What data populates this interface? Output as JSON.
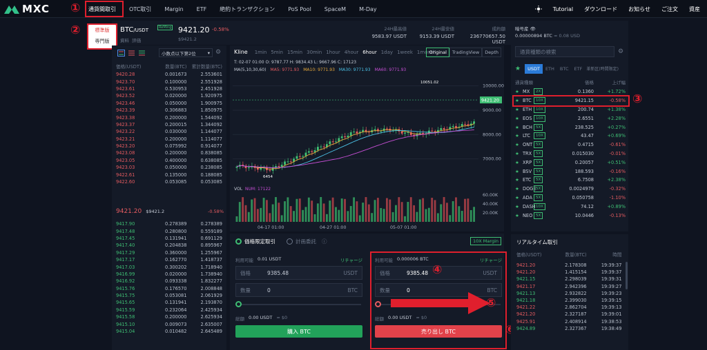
{
  "nav": {
    "logo": "MXC",
    "items": [
      "通貨間取引",
      "OTC取引",
      "Margin",
      "ETF",
      "絶約トランザクション",
      "PoS Pool",
      "SpaceM",
      "M-Day"
    ],
    "right": [
      "Tutorial",
      "ダウンロード",
      "お知らせ",
      "ご注文",
      "資産"
    ],
    "sun_icon": "sun-icon"
  },
  "dropdown": {
    "items": [
      "標準版",
      "専門版"
    ]
  },
  "markers": {
    "m1": "①",
    "m2": "②",
    "m3": "③",
    "m4": "④",
    "m5": "⑤",
    "m6": "⑥"
  },
  "ticker": {
    "pair": "BTC",
    "quote": "/USDT",
    "badge": "ReMing",
    "sub1": "資料",
    "sub2": "評価",
    "price": "9421.20",
    "change": "-0.58%",
    "price_sub": "$9421.2",
    "high_label": "24H最高値",
    "high": "9583.97 USDT",
    "low_label": "24H最安値",
    "low": "9153.39 USDT",
    "vol_label": "成約額",
    "vol": "236770657.50 USDT"
  },
  "orderbook": {
    "precision": "小数点以下第2位",
    "headers": [
      "価格(USDT)",
      "数量(BTC)",
      "累計数量(BTC)"
    ],
    "asks": [
      [
        "9420.28",
        "0.001673",
        "2.553601"
      ],
      [
        "9423.70",
        "0.100000",
        "2.551928"
      ],
      [
        "9423.61",
        "0.530953",
        "2.451928"
      ],
      [
        "9423.52",
        "0.020000",
        "1.920975"
      ],
      [
        "9423.46",
        "0.050000",
        "1.900975"
      ],
      [
        "9423.39",
        "0.306883",
        "1.850975"
      ],
      [
        "9423.38",
        "0.200000",
        "1.544092"
      ],
      [
        "9423.37",
        "0.200015",
        "1.344092"
      ],
      [
        "9423.22",
        "0.030000",
        "1.144077"
      ],
      [
        "9423.21",
        "0.200000",
        "1.114077"
      ],
      [
        "9423.20",
        "0.075992",
        "0.914077"
      ],
      [
        "9423.08",
        "0.200000",
        "0.838085"
      ],
      [
        "9423.05",
        "0.400000",
        "0.638085"
      ],
      [
        "9423.03",
        "0.050000",
        "0.238085"
      ],
      [
        "9422.61",
        "0.135000",
        "0.188085"
      ],
      [
        "9422.60",
        "0.053085",
        "0.053085"
      ]
    ],
    "mid_price": "9421.20",
    "mid_usd": "$9421.2",
    "mid_change": "-0.58%",
    "bids": [
      [
        "9417.90",
        "0.278389",
        "0.278389"
      ],
      [
        "9417.48",
        "0.280800",
        "0.559189"
      ],
      [
        "9417.45",
        "0.131941",
        "0.691129"
      ],
      [
        "9417.40",
        "0.204838",
        "0.895967"
      ],
      [
        "9417.29",
        "0.360000",
        "1.255967"
      ],
      [
        "9417.17",
        "0.162770",
        "1.418737"
      ],
      [
        "9417.03",
        "0.300202",
        "1.718940"
      ],
      [
        "9416.99",
        "0.020000",
        "1.738940"
      ],
      [
        "9416.92",
        "0.093338",
        "1.832277"
      ],
      [
        "9415.76",
        "0.176570",
        "2.008848"
      ],
      [
        "9415.75",
        "0.053081",
        "2.061929"
      ],
      [
        "9415.65",
        "0.131941",
        "2.193870"
      ],
      [
        "9415.59",
        "0.232064",
        "2.425934"
      ],
      [
        "9415.58",
        "0.200000",
        "2.625934"
      ],
      [
        "9415.10",
        "0.009073",
        "2.635007"
      ],
      [
        "9415.04",
        "0.010482",
        "2.645489"
      ]
    ]
  },
  "chart": {
    "title": "Kline",
    "intervals": [
      "1min",
      "5min",
      "15min",
      "30min",
      "1hour",
      "4hour",
      "6hour",
      "1day",
      "1week",
      "1month"
    ],
    "active_interval": "6hour",
    "views": [
      "Original",
      "TradingView",
      "Depth"
    ],
    "ohlc": "T: 02-07 01:00   O: 9787.77   H: 9834.43   L: 9667.96   C: 17123",
    "ma_label": "MA(5,10,30,60)",
    "ma5": "MA5: 9771.93",
    "ma10": "MA10: 9771.93",
    "ma30": "MA30: 9771.93",
    "ma60": "MA60: 9771.93",
    "high_mark": "10051.02",
    "low_mark": "6454",
    "current": "9421.20",
    "y_ticks": [
      "10000.00",
      "9000.00",
      "8000.00",
      "7000.00"
    ],
    "vol_label": "VOL",
    "vol_value": "NUM: 17122",
    "vol_ticks": [
      "60.00K",
      "40.00K",
      "20.00K"
    ],
    "x_ticks": [
      "04-17 01:00",
      "04-27 01:00",
      "05-07 01:00"
    ]
  },
  "trade": {
    "tab1": "価格限定取引",
    "tab2": "計画委託",
    "margin": "10X Margin",
    "buy": {
      "avail_label": "利用可能",
      "avail": "0.01 USDT",
      "recharge": "リチャージ",
      "price_label": "価格",
      "price": "9385.48",
      "price_unit": "USDT",
      "qty_label": "数量",
      "qty": "0",
      "qty_unit": "BTC",
      "total_label": "総額",
      "total": "0.00 USDT",
      "total_usd": "≈ $0",
      "button": "購入 BTC"
    },
    "sell": {
      "avail_label": "利用可能",
      "avail": "0.000006 BTC",
      "recharge": "リチャージ",
      "price_label": "価格",
      "price": "9385.48",
      "price_unit": "USDT",
      "qty_label": "数量",
      "qty": "0",
      "qty_unit": "BTC",
      "total_label": "総額",
      "total": "0.00 USDT",
      "total_usd": "≈ $0",
      "button": "売り出し BTC"
    }
  },
  "market": {
    "fav_label": "暗号産",
    "fav_value": "0.00000894 BTC",
    "fav_usd": "≈ 0.08 USD",
    "search_placeholder": "通貨種類の検索",
    "tabs": [
      "USDT",
      "ETH",
      "BTC",
      "ETF",
      "革新区(時間限定)"
    ],
    "headers": [
      "通貨種類",
      "価格",
      "上げ幅"
    ],
    "rows": [
      [
        "MX",
        "2X",
        "0.1360",
        "+1.72%"
      ],
      [
        "BTC",
        "10X",
        "9421.15",
        "-0.58%"
      ],
      [
        "ETH",
        "10X",
        "200.74",
        "+1.38%"
      ],
      [
        "EOS",
        "10X",
        "2.6551",
        "+2.28%"
      ],
      [
        "BCH",
        "5X",
        "238.525",
        "+0.27%"
      ],
      [
        "LTC",
        "10X",
        "43.47",
        "+0.69%"
      ],
      [
        "ONT",
        "5X",
        "0.4715",
        "-0.61%"
      ],
      [
        "TRX",
        "5X",
        "0.015030",
        "-0.01%"
      ],
      [
        "XRP",
        "5X",
        "0.20057",
        "+0.51%"
      ],
      [
        "BSV",
        "5X",
        "188.593",
        "-0.16%"
      ],
      [
        "ETC",
        "5X",
        "6.7508",
        "+2.38%"
      ],
      [
        "DOGE",
        "5X",
        "0.0024979",
        "-0.32%"
      ],
      [
        "ADA",
        "5X",
        "0.050758",
        "-1.10%"
      ],
      [
        "DASH",
        "10X",
        "74.12",
        "+0.89%"
      ],
      [
        "NEO",
        "5X",
        "10.0446",
        "-0.13%"
      ]
    ]
  },
  "trades": {
    "title": "リアルタイム取引",
    "headers": [
      "価格(USDT)",
      "数量(BTC)",
      "時間"
    ],
    "rows": [
      [
        "9421.20",
        "2.178308",
        "19:39:37",
        "s"
      ],
      [
        "9421.20",
        "1.415154",
        "19:39:37",
        "s"
      ],
      [
        "9421.15",
        "2.298039",
        "19:39:31",
        "b"
      ],
      [
        "9421.17",
        "2.942396",
        "19:39:27",
        "s"
      ],
      [
        "9421.13",
        "2.932822",
        "19:39:23",
        "b"
      ],
      [
        "9421.18",
        "2.399030",
        "19:39:15",
        "b"
      ],
      [
        "9421.22",
        "2.862704",
        "19:39:13",
        "s"
      ],
      [
        "9421.20",
        "2.327187",
        "19:39:01",
        "s"
      ],
      [
        "9425.91",
        "2.408914",
        "19:38:53",
        "s"
      ],
      [
        "9424.89",
        "2.327367",
        "19:38:49",
        "b"
      ]
    ]
  },
  "colors": {
    "buy": "#3fbf74",
    "sell": "#e55b60",
    "annotation": "#e01f2d"
  }
}
